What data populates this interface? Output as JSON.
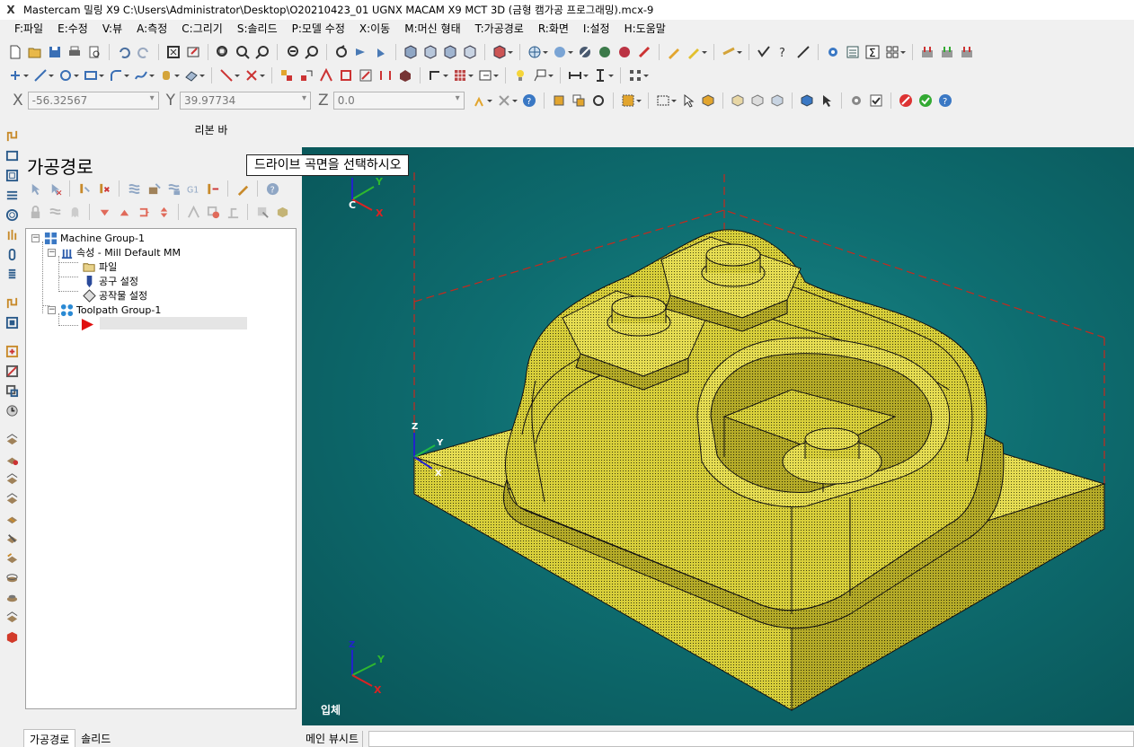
{
  "window": {
    "title": "Mastercam 밀링 X9  C:\\Users\\Administrator\\Desktop\\O20210423_01 UGNX MACAM X9 MCT 3D (금형 캠가공 프로그래밍).mcx-9",
    "app_icon": "X"
  },
  "menu": [
    "F:파일",
    "E:수정",
    "V:뷰",
    "A:측정",
    "C:그리기",
    "S:솔리드",
    "P:모델 수정",
    "X:이동",
    "M:머신 형태",
    "T:가공경로",
    "R:화면",
    "I:설정",
    "H:도움말"
  ],
  "coords": {
    "x_label": "X",
    "x_value": "-56.32567",
    "y_label": "Y",
    "y_value": "39.97734",
    "z_label": "Z",
    "z_value": "0.0"
  },
  "ribbon": {
    "label": "리본 바"
  },
  "manager": {
    "title": "가공경로",
    "tree": {
      "machine_group": "Machine Group-1",
      "properties": "속성 - Mill Default MM",
      "files": "파일",
      "tool_settings": "공구 설정",
      "stock_setup": "공작물 설정",
      "toolpath_group": "Toolpath Group-1"
    },
    "ops_button_label": "G1",
    "tabs": [
      "가공경로",
      "솔리드"
    ]
  },
  "viewport": {
    "prompt": "드라이브 곡면을 선택하시오",
    "view_name": "입체",
    "background_color": "#0e6d70",
    "part_color": "#d8cf3a",
    "top_gnomon": {
      "c": "C",
      "x": "X",
      "y": "Y"
    },
    "origin_gnomon": {
      "z": "Z",
      "y": "Y",
      "x": "X"
    },
    "bottom_gnomon": {
      "z": "Z",
      "y": "Y",
      "x": "X"
    }
  },
  "viewsheet": {
    "tab": "메인 뷰시트"
  }
}
